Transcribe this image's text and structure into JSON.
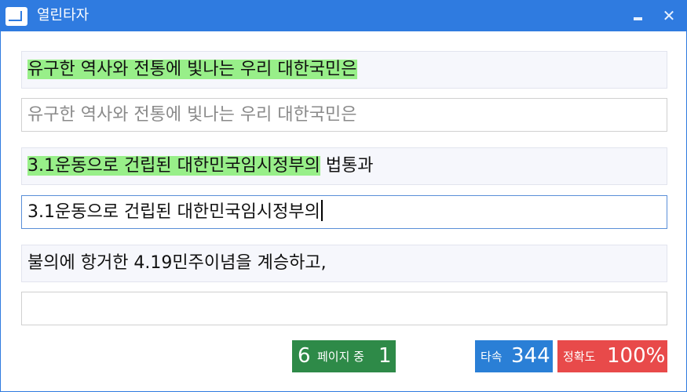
{
  "window": {
    "title": "열린타자",
    "minimize_symbol": "",
    "close_symbol": "✕"
  },
  "lines": [
    {
      "reference_typed": "유구한 역사와 전통에 빛나는 우리 대한국민은",
      "reference_rest": "",
      "input_value": "",
      "input_placeholder": "유구한 역사와 전통에 빛나는 우리 대한국민은"
    },
    {
      "reference_typed": "3.1운동으로 건립된 대한민국임시정부의",
      "reference_rest": " 법통과",
      "input_value": "3.1운동으로 건립된 대한민국임시정부의",
      "input_placeholder": ""
    },
    {
      "reference_typed": "",
      "reference_rest": "불의에 항거한 4.19민주이념을 계승하고,",
      "input_value": "",
      "input_placeholder": ""
    }
  ],
  "status": {
    "page_total": "6",
    "page_text": "페이지 중",
    "page_current": "1",
    "speed_label": "타속",
    "speed_value": "344",
    "accuracy_label": "정확도",
    "accuracy_value": "100%"
  },
  "colors": {
    "titlebar": "#2f7be0",
    "typed_highlight": "#98ef89",
    "page_badge": "#2e8a48",
    "speed_badge": "#2a7fd6",
    "accuracy_badge": "#e84a4a"
  }
}
